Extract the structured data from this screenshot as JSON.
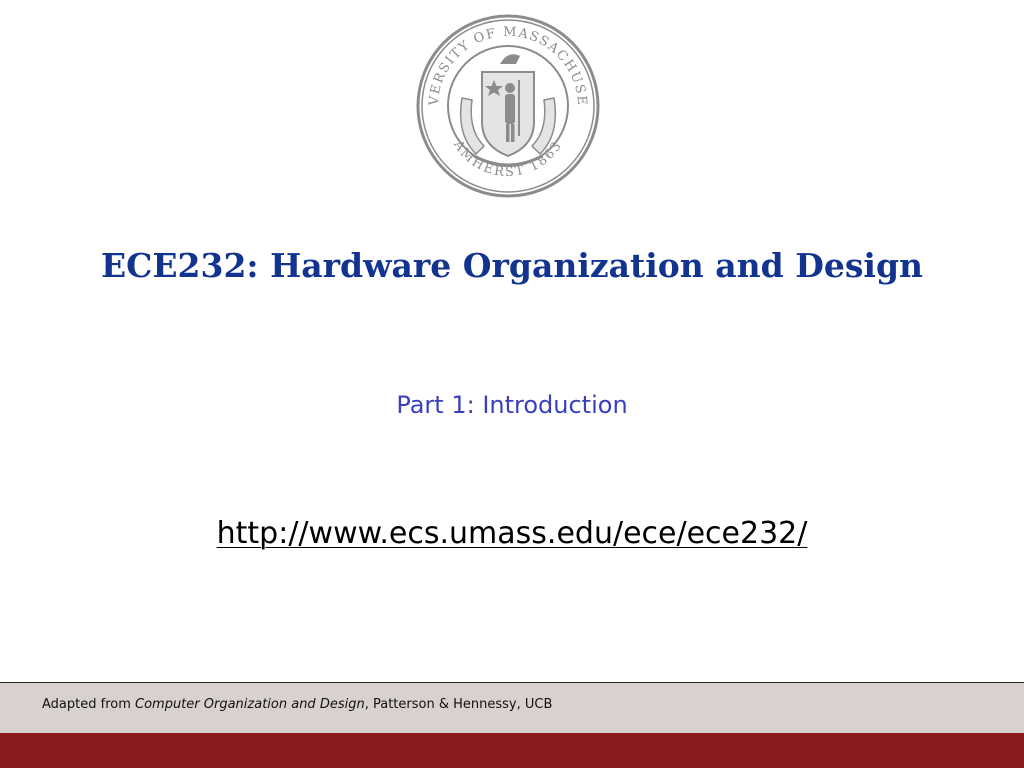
{
  "seal": {
    "ring_text_top": "UNIVERSITY OF MASSACHUSETTS",
    "ring_text_bottom": "AMHERST 1863"
  },
  "slide": {
    "title": "ECE232: Hardware Organization and Design",
    "subtitle": "Part 1: Introduction",
    "url": "http://www.ecs.umass.edu/ece/ece232/"
  },
  "footer": {
    "prefix": "Adapted from ",
    "book_title": "Computer Organization and Design",
    "suffix": ", Patterson & Hennessy, UCB"
  },
  "colors": {
    "title": "#12348f",
    "subtitle": "#3a3fbd",
    "footer_band": "#d8d1cf",
    "bottom_bar": "#8a1c1f",
    "seal": "#8c8c8c"
  }
}
